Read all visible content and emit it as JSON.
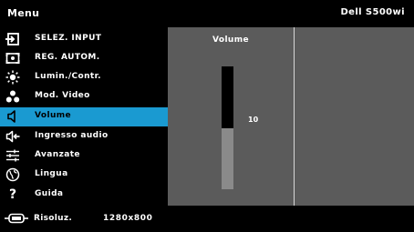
{
  "header": {
    "title": "Menu",
    "model": "Dell S500wi"
  },
  "menu": {
    "items": [
      {
        "label": "SELEZ. INPUT",
        "icon": "input-source-icon"
      },
      {
        "label": "REG. AUTOM.",
        "icon": "auto-adjust-icon"
      },
      {
        "label": "Lumin./Contr.",
        "icon": "brightness-icon"
      },
      {
        "label": "Mod. Video",
        "icon": "video-mode-icon"
      },
      {
        "label": "Volume",
        "icon": "speaker-icon",
        "selected": true
      },
      {
        "label": "Ingresso audio",
        "icon": "audio-input-icon"
      },
      {
        "label": "Avanzate",
        "icon": "settings-sliders-icon"
      },
      {
        "label": "Lingua",
        "icon": "globe-icon"
      },
      {
        "label": "Guida",
        "icon": "help-icon"
      }
    ]
  },
  "detail": {
    "title": "Volume",
    "value": "10",
    "level_fraction": 0.5
  },
  "footer": {
    "label": "Risoluz.",
    "value": "1280x800",
    "icon": "resolution-icon"
  },
  "colors": {
    "selected": "#1a9ad1",
    "panel": "#5b5b5b",
    "background": "#000000"
  }
}
